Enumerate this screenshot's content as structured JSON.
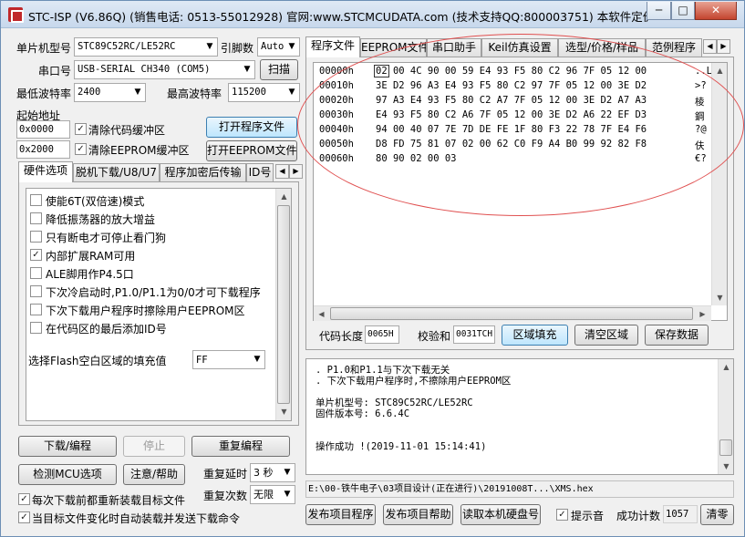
{
  "window": {
    "title": "STC-ISP (V6.86Q) (销售电话: 0513-55012928) 官网:www.STCMCUDATA.com  (技术支持QQ:800003751) 本软件定价: 60...",
    "min": "─",
    "max": "□",
    "close": "✕"
  },
  "left": {
    "mcu_label": "单片机型号",
    "mcu_value": "STC89C52RC/LE52RC",
    "pin_label": "引脚数",
    "pin_value": "Auto",
    "port_label": "串口号",
    "port_value": "USB-SERIAL CH340 (COM5)",
    "scan_btn": "扫描",
    "min_baud_label": "最低波特率",
    "min_baud_value": "2400",
    "max_baud_label": "最高波特率",
    "max_baud_value": "115200",
    "start_addr_label": "起始地址",
    "addr1": "0x0000",
    "clear_code": "清除代码缓冲区",
    "open_prog": "打开程序文件",
    "addr2": "0x2000",
    "clear_eeprom": "清除EEPROM缓冲区",
    "open_eeprom": "打开EEPROM文件"
  },
  "hw_tabs": [
    "硬件选项",
    "脱机下载/U8/U7",
    "程序加密后传输",
    "ID号"
  ],
  "hw_options": [
    {
      "label": "使能6T(双倍速)模式",
      "checked": false
    },
    {
      "label": "降低振荡器的放大增益",
      "checked": false
    },
    {
      "label": "只有断电才可停止看门狗",
      "checked": false
    },
    {
      "label": "内部扩展RAM可用",
      "checked": true
    },
    {
      "label": "ALE脚用作P4.5口",
      "checked": false
    },
    {
      "label": "下次冷启动时,P1.0/P1.1为0/0才可下载程序",
      "checked": false
    },
    {
      "label": "下次下载用户程序时擦除用户EEPROM区",
      "checked": false
    },
    {
      "label": "在代码区的最后添加ID号",
      "checked": false
    }
  ],
  "flash_fill": {
    "label": "选择Flash空白区域的填充值",
    "value": "FF"
  },
  "bottom_left": {
    "download": "下载/编程",
    "stop": "停止",
    "reprogram": "重复编程",
    "detect": "检测MCU选项",
    "help": "注意/帮助",
    "delay_label": "重复延时",
    "delay_value": "3 秒",
    "count_label": "重复次数",
    "count_value": "无限",
    "reload": "每次下载前都重新装载目标文件",
    "auto_send": "当目标文件变化时自动装载并发送下载命令"
  },
  "right_tabs": [
    "程序文件",
    "EEPROM文件",
    "串口助手",
    "Keil仿真设置",
    "选型/价格/样品",
    "范例程序"
  ],
  "hex_rows": [
    {
      "addr": "00000h",
      "bytes": "02 00 4C 90 00 59 E4 93 F5 80 C2 96 7F 05 12 00",
      "ascii": "..L"
    },
    {
      "addr": "00010h",
      "bytes": "3E D2 96 A3 E4 93 F5 80 C2 97 7F 05 12 00 3E D2",
      "ascii": ">?"
    },
    {
      "addr": "00020h",
      "bytes": "97 A3 E4 93 F5 80 C2 A7 7F 05 12 00 3E D2 A7 A3",
      "ascii": "棱"
    },
    {
      "addr": "00030h",
      "bytes": "E4 93 F5 80 C2 A6 7F 05 12 00 3E D2 A6 22 EF D3",
      "ascii": "鋼"
    },
    {
      "addr": "00040h",
      "bytes": "94 00 40 07 7E 7D DE FE 1F 80 F3 22 78 7F E4 F6",
      "ascii": "?@"
    },
    {
      "addr": "00050h",
      "bytes": "D8 FD 75 81 07 02 00 62 C0 F9 A4 B0 99 92 82 F8",
      "ascii": "伕"
    },
    {
      "addr": "00060h",
      "bytes": "80 90 02 00 03",
      "ascii": "€?"
    }
  ],
  "code_info": {
    "len_label": "代码长度",
    "len_value": "0065H",
    "sum_label": "校验和",
    "sum_value": "0031TCH",
    "fill_btn": "区域填充",
    "clear_btn": "清空区域",
    "save_btn": "保存数据"
  },
  "log_lines": [
    ". P1.0和P1.1与下次下载无关",
    ". 下次下载用户程序时,不擦除用户EEPROM区",
    "",
    "单片机型号: STC89C52RC/LE52RC",
    "固件版本号: 6.6.4C",
    "",
    "",
    "操作成功 !(2019-11-01 15:14:41)"
  ],
  "file_path": "E:\\00-铁牛电子\\03项目设计(正在进行)\\20191008T...\\XMS.hex",
  "bottom_right": {
    "publish": "发布项目程序",
    "publish_help": "发布项目帮助",
    "read_disk": "读取本机硬盘号",
    "sound": "提示音",
    "success_label": "成功计数",
    "success_value": "1057",
    "clear": "清零"
  }
}
